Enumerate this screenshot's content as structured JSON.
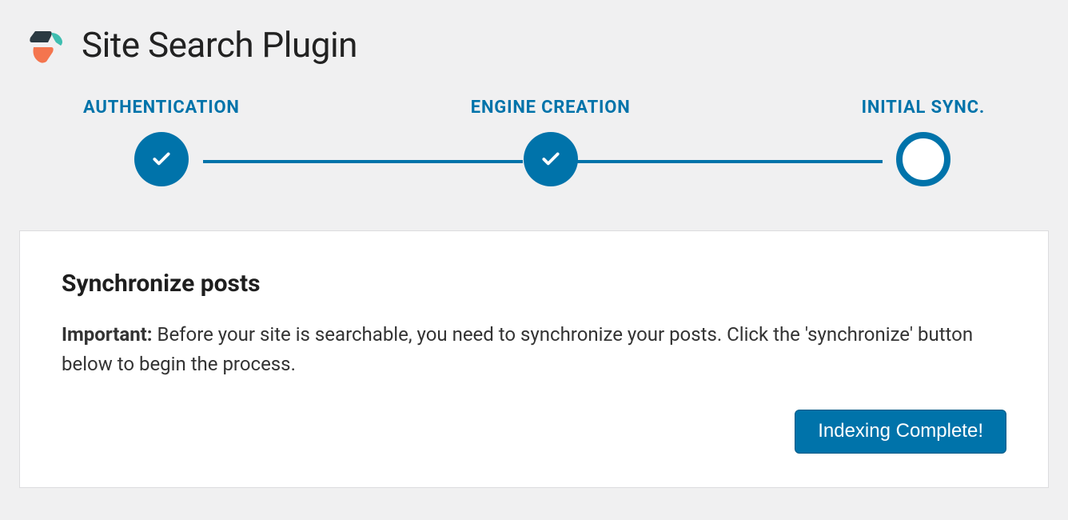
{
  "header": {
    "title": "Site Search Plugin"
  },
  "stepper": {
    "steps": [
      {
        "label": "AUTHENTICATION",
        "state": "done"
      },
      {
        "label": "ENGINE CREATION",
        "state": "done"
      },
      {
        "label": "INITIAL SYNC.",
        "state": "current"
      }
    ]
  },
  "card": {
    "title": "Synchronize posts",
    "important_label": "Important:",
    "body_text": " Before your site is searchable, you need to synchronize your posts. Click the 'synchronize' button below to begin the process.",
    "button_label": "Indexing Complete!"
  }
}
